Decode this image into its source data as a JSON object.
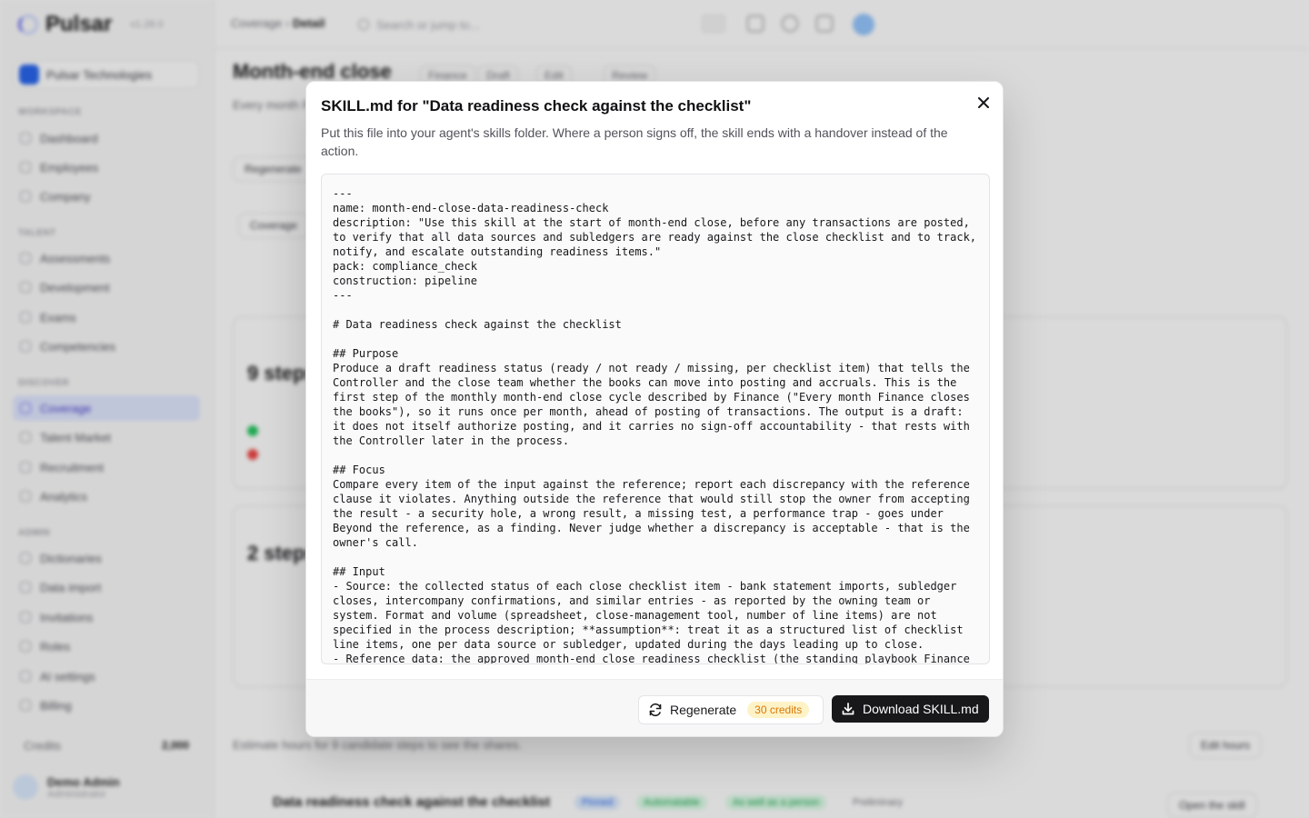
{
  "app": {
    "brand": "Pulsar",
    "version": "v1.28.0",
    "org": "Pulsar Technologies",
    "nav": {
      "sections": [
        "WORKSPACE",
        "TALENT",
        "DISCOVER",
        "ADMIN"
      ],
      "items": [
        "Dashboard",
        "Employees",
        "Company",
        "Assessments",
        "Development",
        "Exams",
        "Competencies",
        "Coverage",
        "Talent Market",
        "Recruitment",
        "Analytics",
        "Dictionaries",
        "Data import",
        "Invitations",
        "Roles",
        "AI settings",
        "Billing"
      ]
    },
    "credits_label": "Credits",
    "credits_value": "2,000",
    "user": {
      "name": "Demo Admin",
      "role": "Administrator"
    }
  },
  "topbar": {
    "breadcrumb_parent": "Coverage",
    "breadcrumb_current": "Detail",
    "search_placeholder": "Search or jump to..."
  },
  "page": {
    "title": "Month-end close",
    "chips": [
      "Finance",
      "Draft",
      "Edit",
      "Review"
    ],
    "intro": "Every month Finance closes the books...",
    "regenerate": "Regenerate",
    "coverage": "Coverage",
    "card1_big": "9 steps",
    "card2_big": "2 steps",
    "footer_hint": "Estimate hours for 9 candidate steps to see the shares.",
    "edit_hours": "Edit hours",
    "row_title": "Data readiness check against the checklist",
    "row_tags": [
      "Pinned",
      "Automatable",
      "As well as a person",
      "Preliminary"
    ],
    "open_skill": "Open the skill"
  },
  "modal": {
    "title": "SKILL.md for \"Data readiness check against the checklist\"",
    "description": "Put this file into your agent's skills folder. Where a person signs off, the skill ends with a handover instead of the action.",
    "code": "---\nname: month-end-close-data-readiness-check\ndescription: \"Use this skill at the start of month-end close, before any transactions are posted,\nto verify that all data sources and subledgers are ready against the close checklist and to track,\nnotify, and escalate outstanding readiness items.\"\npack: compliance_check\nconstruction: pipeline\n---\n\n# Data readiness check against the checklist\n\n## Purpose\nProduce a draft readiness status (ready / not ready / missing, per checklist item) that tells the\nController and the close team whether the books can move into posting and accruals. This is the\nfirst step of the monthly month-end close cycle described by Finance (\"Every month Finance closes\nthe books\"), so it runs once per month, ahead of posting of transactions. The output is a draft:\nit does not itself authorize posting, and it carries no sign-off accountability - that rests with\nthe Controller later in the process.\n\n## Focus\nCompare every item of the input against the reference; report each discrepancy with the reference\nclause it violates. Anything outside the reference that would still stop the owner from accepting\nthe result - a security hole, a wrong result, a missing test, a performance trap - goes under\nBeyond the reference, as a finding. Never judge whether a discrepancy is acceptable - that is the\nowner's call.\n\n## Input\n- Source: the collected status of each close checklist item - bank statement imports, subledger\ncloses, intercompany confirmations, and similar entries - as reported by the owning team or\nsystem. Format and volume (spreadsheet, close-management tool, number of line items) are not\nspecified in the process description; **assumption**: treat it as a structured list of checklist\nline items, one per data source or subledger, updated during the days leading up to close.\n- Reference data: the approved month-end close readiness checklist (the standing playbook Finance",
    "regenerate_label": "Regenerate",
    "credits_badge": "30 credits",
    "download_label": "Download SKILL.md"
  }
}
